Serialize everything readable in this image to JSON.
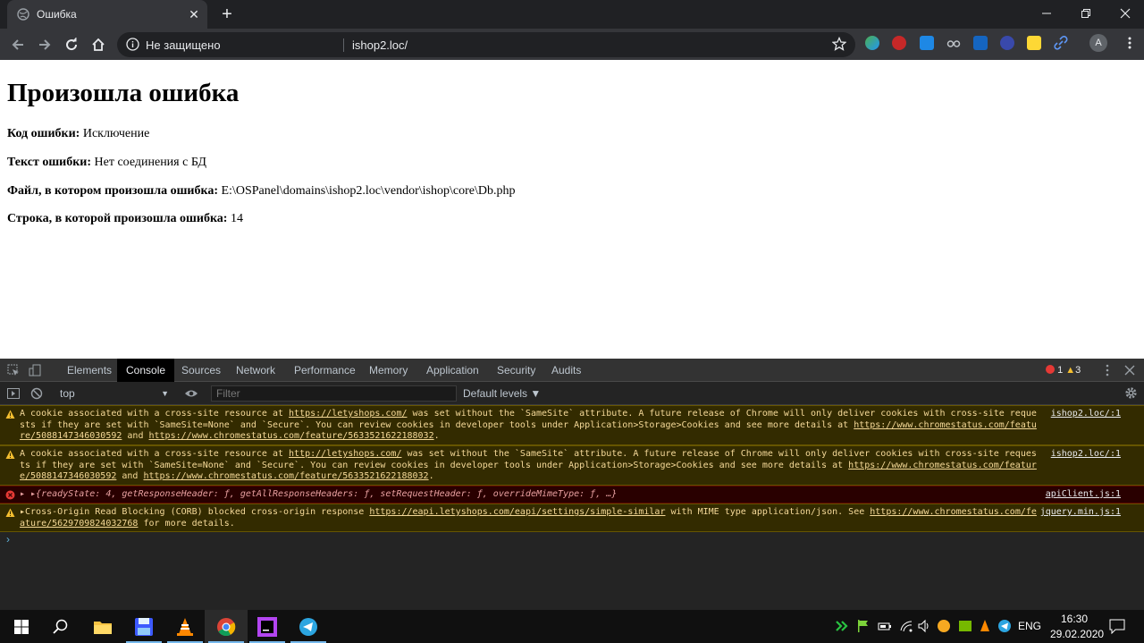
{
  "browser": {
    "tab_title": "Ошибка",
    "security_label": "Не защищено",
    "url": "ishop2.loc/",
    "profile_initial": "A"
  },
  "page": {
    "heading": "Произошла ошибка",
    "rows": [
      {
        "label": "Код ошибки:",
        "value": "Исключение"
      },
      {
        "label": "Текст ошибки:",
        "value": "Нет соединения с БД"
      },
      {
        "label": "Файл, в котором произошла ошибка:",
        "value": "E:\\OSPanel\\domains\\ishop2.loc\\vendor\\ishop\\core\\Db.php"
      },
      {
        "label": "Строка, в которой произошла ошибка:",
        "value": "14"
      }
    ]
  },
  "devtools": {
    "tabs": [
      "Elements",
      "Console",
      "Sources",
      "Network",
      "Performance",
      "Memory",
      "Application",
      "Security",
      "Audits"
    ],
    "active_tab": "Console",
    "error_count": "1",
    "warning_count": "3",
    "context": "top",
    "filter_placeholder": "Filter",
    "levels_label": "Default levels ▼",
    "messages": [
      {
        "level": "warning",
        "text_a": "A cookie associated with a cross-site resource at ",
        "link1": "https://letyshops.com/",
        "text_b": " was set without the `SameSite` attribute. A future release of Chrome will only deliver cookies with cross-site requests if they are set with `SameSite=None` and `Secure`. You can review cookies in developer tools under Application>Storage>Cookies and see more details at ",
        "link2": "https://www.chromestatus.com/feature/5088147346030592",
        "text_c": " and ",
        "link3": "https://www.chromestatus.com/feature/5633521622188032",
        "text_d": ".",
        "source": "ishop2.loc/:1"
      },
      {
        "level": "warning",
        "text_a": "A cookie associated with a cross-site resource at ",
        "link1": "http://letyshops.com/",
        "text_b": " was set without the `SameSite` attribute. A future release of Chrome will only deliver cookies with cross-site requests if they are set with `SameSite=None` and `Secure`. You can review cookies in developer tools under Application>Storage>Cookies and see more details at ",
        "link2": "https://www.chromestatus.com/feature/5088147346030592",
        "text_c": " and ",
        "link3": "https://www.chromestatus.com/feature/5633521622188032",
        "text_d": ".",
        "source": "ishop2.loc/:1"
      },
      {
        "level": "error",
        "text": "▸ ▸{readyState: 4, getResponseHeader: ƒ, getAllResponseHeaders: ƒ, setRequestHeader: ƒ, overrideMimeType: ƒ, …}",
        "source": "apiClient.js:1"
      },
      {
        "level": "warning",
        "text_a": "▸Cross-Origin Read Blocking (CORB) blocked cross-origin response ",
        "link1": "https://eapi.letyshops.com/eapi/settings/simple-similar",
        "text_b": " with MIME type application/json. See ",
        "link2": "https://www.chromestatus.com/feature/5629709824032768",
        "text_c": " for more details.",
        "source": "jquery.min.js:1"
      }
    ],
    "prompt": "›"
  },
  "taskbar": {
    "language": "ENG",
    "time": "16:30",
    "date": "29.02.2020"
  }
}
